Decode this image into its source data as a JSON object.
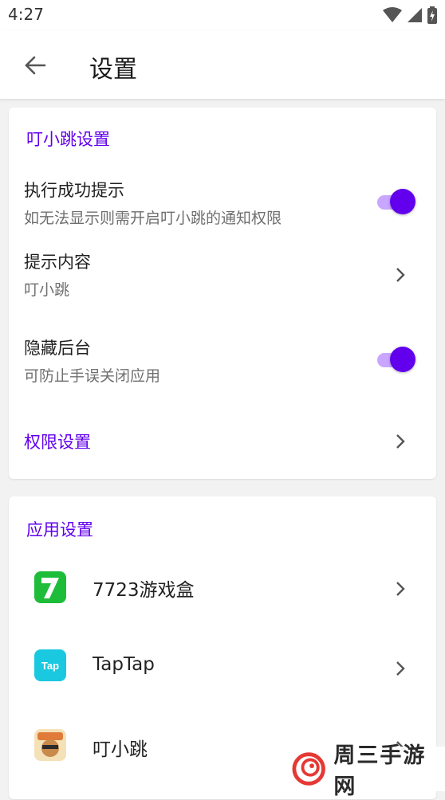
{
  "status": {
    "time": "4:27"
  },
  "appbar": {
    "title": "设置"
  },
  "card1": {
    "section_title": "叮小跳设置",
    "success_tip": {
      "title": "执行成功提示",
      "subtitle": "如无法显示则需开启叮小跳的通知权限",
      "enabled": true
    },
    "tip_content": {
      "title": "提示内容",
      "value": "叮小跳"
    },
    "hide_background": {
      "title": "隐藏后台",
      "subtitle": "可防止手误关闭应用",
      "enabled": true
    },
    "permission_settings": {
      "title": "权限设置"
    }
  },
  "card2": {
    "section_title": "应用设置",
    "apps": [
      {
        "name": "7723游戏盒"
      },
      {
        "name": "TapTap",
        "icon_text": "Tap"
      },
      {
        "name": "叮小跳"
      }
    ]
  },
  "watermark": {
    "text": "周三手游网"
  },
  "colors": {
    "accent": "#6200ee",
    "toggle_track": "#c9a6ff",
    "app1": "#1dbd3a",
    "app2": "#1ac8e0"
  }
}
